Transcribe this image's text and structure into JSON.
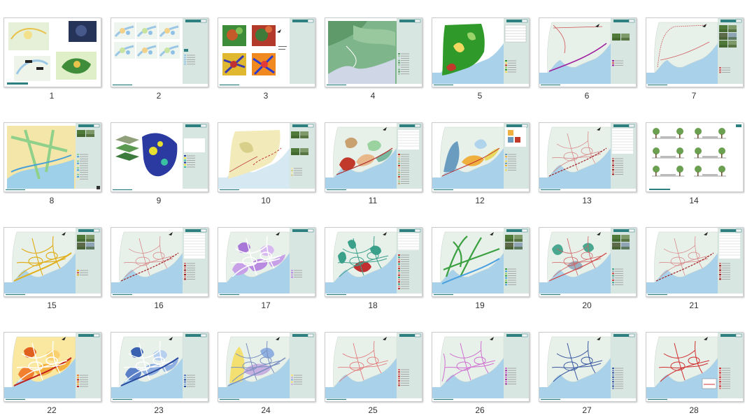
{
  "pages": [
    {
      "label": "1",
      "kind": "collage"
    },
    {
      "label": "2",
      "kind": "grid6"
    },
    {
      "label": "3",
      "kind": "terrain4"
    },
    {
      "label": "4",
      "kind": "relief"
    },
    {
      "label": "5",
      "kind": "landuse"
    },
    {
      "label": "6",
      "kind": "route"
    },
    {
      "label": "7",
      "kind": "routephotos"
    },
    {
      "label": "8",
      "kind": "yellowmap"
    },
    {
      "label": "9",
      "kind": "layers"
    },
    {
      "label": "10",
      "kind": "beige"
    },
    {
      "label": "11",
      "kind": "zoning"
    },
    {
      "label": "12",
      "kind": "bluezone"
    },
    {
      "label": "13",
      "kind": "roads"
    },
    {
      "label": "14",
      "kind": "sections"
    },
    {
      "label": "15",
      "kind": "yellowlines"
    },
    {
      "label": "16",
      "kind": "roads"
    },
    {
      "label": "17",
      "kind": "purple"
    },
    {
      "label": "18",
      "kind": "tealred"
    },
    {
      "label": "19",
      "kind": "green"
    },
    {
      "label": "20",
      "kind": "tealgrey"
    },
    {
      "label": "21",
      "kind": "roads"
    },
    {
      "label": "22",
      "kind": "orange"
    },
    {
      "label": "23",
      "kind": "blues"
    },
    {
      "label": "24",
      "kind": "yellowblue"
    },
    {
      "label": "25",
      "kind": "redlines"
    },
    {
      "label": "26",
      "kind": "magenta"
    },
    {
      "label": "27",
      "kind": "navy"
    },
    {
      "label": "28",
      "kind": "redlines2"
    }
  ],
  "colors": {
    "sidebar": "#d8e6e2",
    "header": "#2e7f80",
    "sea": "#a9d2ea",
    "land": "#e8f0ea"
  }
}
